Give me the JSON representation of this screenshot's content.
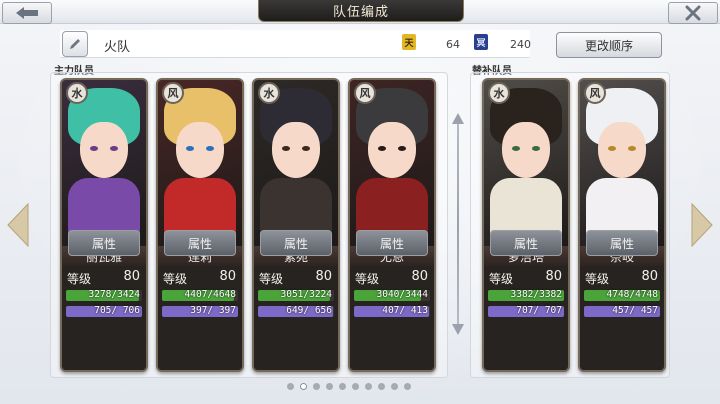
{
  "header": {
    "title": "队伍编成"
  },
  "team": {
    "name": "火队"
  },
  "resources": [
    {
      "icon": "gold-resource-icon",
      "glyph": "天",
      "value": "64",
      "color": "#e2b627"
    },
    {
      "icon": "blue-resource-icon",
      "glyph": "冥",
      "value": "240",
      "color": "#2b3f8f"
    }
  ],
  "buttons": {
    "change_order": "更改顺序"
  },
  "sections": {
    "main": "主力队员",
    "reserve": "替补队员"
  },
  "level_label": "等级",
  "attr_label": "属性",
  "members": [
    {
      "name": "丽瓦雅",
      "level": "80",
      "hp": "3278/3424",
      "mp": "705/ 706",
      "hp_frac": 0.957,
      "mp_frac": 0.998,
      "element": "水",
      "hair": "#3fbfa6",
      "outfit": "#7a4aa8",
      "eyes": "#6a3b8a"
    },
    {
      "name": "莲莉",
      "level": "80",
      "hp": "4407/4648",
      "mp": "397/ 397",
      "hp_frac": 0.948,
      "mp_frac": 1.0,
      "element": "风",
      "hair": "#e9c06a",
      "outfit": "#c22a2a",
      "eyes": "#2d6fb8"
    },
    {
      "name": "紫苑",
      "level": "80",
      "hp": "3051/3224",
      "mp": "649/ 656",
      "hp_frac": 0.946,
      "mp_frac": 0.989,
      "element": "水",
      "hair": "#2d2b33",
      "outfit": "#3a332f",
      "eyes": "#3a2a1a"
    },
    {
      "name": "尤恩",
      "level": "80",
      "hp": "3040/3444",
      "mp": "407/ 413",
      "hp_frac": 0.883,
      "mp_frac": 0.985,
      "element": "风",
      "hair": "#3b3a3c",
      "outfit": "#8b2020",
      "eyes": "#2a1a1a"
    },
    {
      "name": "萝洁塔",
      "level": "80",
      "hp": "3382/3382",
      "mp": "707/ 707",
      "hp_frac": 1.0,
      "mp_frac": 1.0,
      "element": "水",
      "hair": "#2a221c",
      "outfit": "#e9e4d6",
      "eyes": "#3c6b3a"
    },
    {
      "name": "奈岐",
      "level": "80",
      "hp": "4748/4748",
      "mp": "457/ 457",
      "hp_frac": 1.0,
      "mp_frac": 1.0,
      "element": "风",
      "hair": "#eef0f4",
      "outfit": "#f2f0f2",
      "eyes": "#b68a2a"
    }
  ],
  "pager": {
    "count": 10,
    "active": 1
  },
  "colors": {
    "hp": "#4aa43a",
    "mp": "#7d69c7"
  }
}
